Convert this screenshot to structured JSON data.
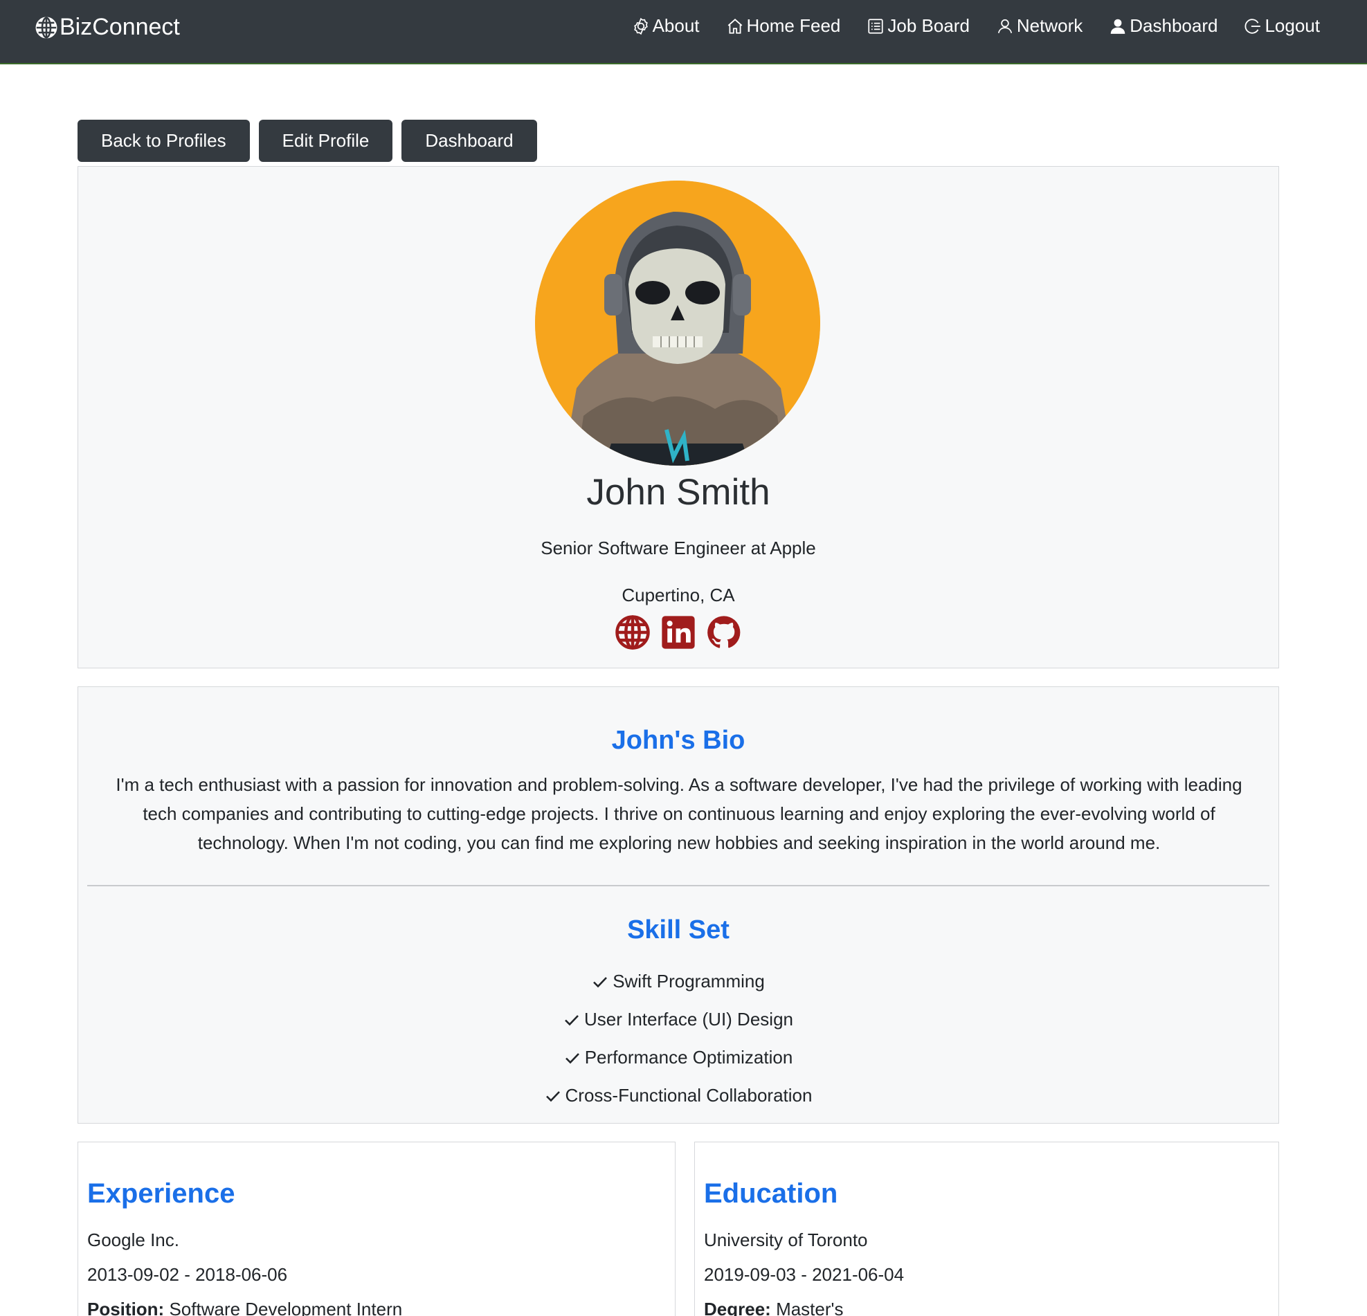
{
  "navbar": {
    "brand": "BizConnect",
    "items": [
      {
        "label": "About",
        "icon": "badge-icon"
      },
      {
        "label": "Home Feed",
        "icon": "house-icon"
      },
      {
        "label": "Job Board",
        "icon": "list-icon"
      },
      {
        "label": "Network",
        "icon": "person-outline-icon"
      },
      {
        "label": "Dashboard",
        "icon": "person-fill-icon"
      },
      {
        "label": "Logout",
        "icon": "logout-icon"
      }
    ]
  },
  "actions": {
    "back": "Back to Profiles",
    "edit": "Edit Profile",
    "dashboard": "Dashboard"
  },
  "profile": {
    "name": "John Smith",
    "headline": "Senior Software Engineer at Apple",
    "location": "Cupertino, CA",
    "socials": [
      "website-icon",
      "linkedin-icon",
      "github-icon"
    ]
  },
  "bio": {
    "title": "John's Bio",
    "text": "I'm a tech enthusiast with a passion for innovation and problem-solving. As a software developer, I've had the privilege of working with leading tech companies and contributing to cutting-edge projects. I thrive on continuous learning and enjoy exploring the ever-evolving world of technology. When I'm not coding, you can find me exploring new hobbies and seeking inspiration in the world around me."
  },
  "skills": {
    "title": "Skill Set",
    "items": [
      "Swift Programming",
      "User Interface (UI) Design",
      "Performance Optimization",
      "Cross-Functional Collaboration"
    ]
  },
  "experience": {
    "title": "Experience",
    "company": "Google Inc.",
    "dates": "2013-09-02 - 2018-06-06",
    "position_label": "Position:",
    "position": "Software Development Intern"
  },
  "education": {
    "title": "Education",
    "school": "University of Toronto",
    "dates": "2019-09-03 - 2021-06-04",
    "degree_label": "Degree:",
    "degree": "Master's"
  },
  "colors": {
    "navbar": "#343a40",
    "accent": "#1a6fe8",
    "social": "#a01c1c",
    "avatar_bg": "#f5a623"
  }
}
